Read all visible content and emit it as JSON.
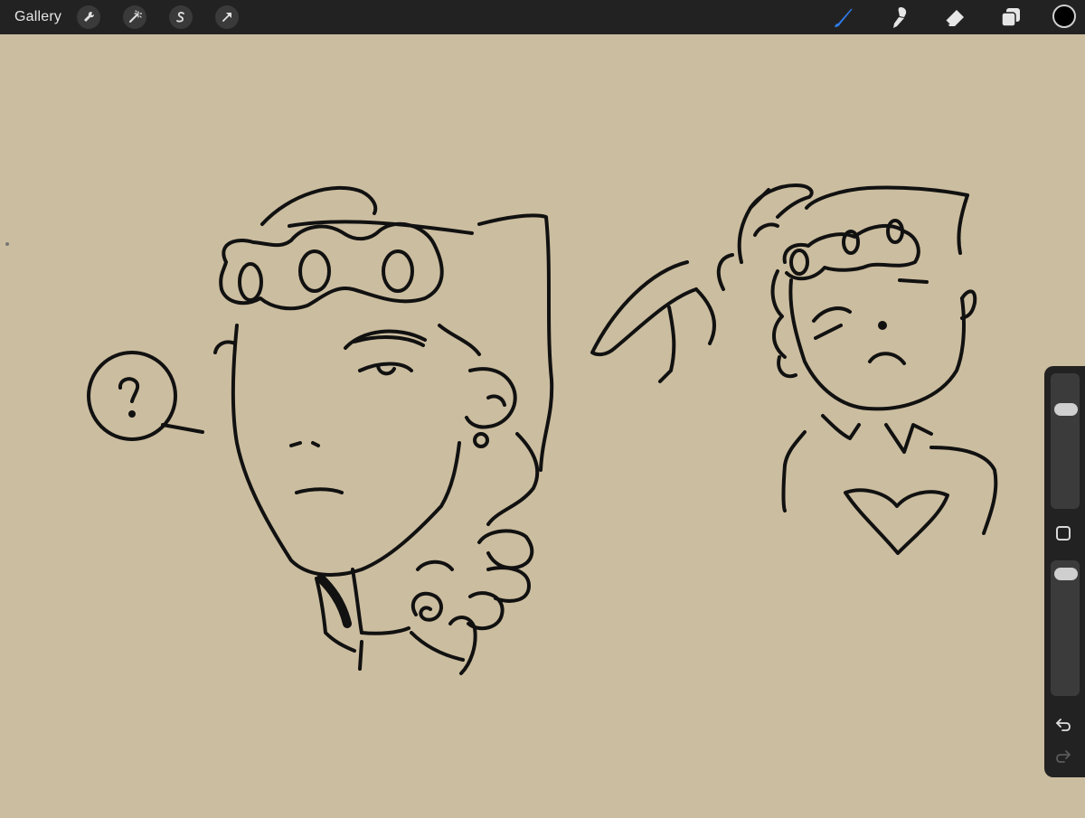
{
  "toolbar": {
    "gallery_label": "Gallery",
    "left_tools": [
      "wrench-icon",
      "magic-wand-icon",
      "selection-s-icon",
      "arrow-transform-icon"
    ],
    "right_tools": [
      "brush-icon",
      "smudge-icon",
      "eraser-icon",
      "layers-icon"
    ],
    "active_tool": "brush",
    "active_color": "#000000",
    "accent": "#2f7ae5"
  },
  "sidebar": {
    "brush_size": 0.23,
    "brush_opacity": 0.03,
    "modify_button": "square-icon",
    "undo": "undo-icon",
    "redo": "redo-icon"
  },
  "canvas": {
    "background": "#cbbd9f",
    "ink": "#111111"
  }
}
